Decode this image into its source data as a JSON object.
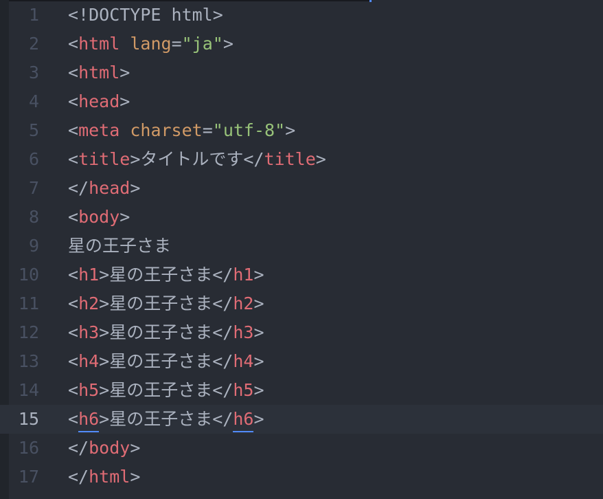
{
  "colors": {
    "background": "#282c34",
    "gutter_text": "#495162",
    "active_line": "#2c313a",
    "tag": "#e06c75",
    "attribute": "#d19a66",
    "string": "#98c379",
    "text": "#abb2bf",
    "bracket_match": "#528bff"
  },
  "editor": {
    "active_line": 15,
    "lines": [
      {
        "no": "1",
        "tokens": [
          {
            "t": "<!DOCTYPE html>",
            "c": "punc"
          }
        ]
      },
      {
        "no": "2",
        "tokens": [
          {
            "t": "<",
            "c": "punc"
          },
          {
            "t": "html",
            "c": "tag"
          },
          {
            "t": " ",
            "c": "punc"
          },
          {
            "t": "lang",
            "c": "attr"
          },
          {
            "t": "=",
            "c": "punc"
          },
          {
            "t": "\"ja\"",
            "c": "str"
          },
          {
            "t": ">",
            "c": "punc"
          }
        ]
      },
      {
        "no": "3",
        "tokens": [
          {
            "t": "<",
            "c": "punc"
          },
          {
            "t": "html",
            "c": "tag"
          },
          {
            "t": ">",
            "c": "punc"
          }
        ]
      },
      {
        "no": "4",
        "tokens": [
          {
            "t": "<",
            "c": "punc"
          },
          {
            "t": "head",
            "c": "tag"
          },
          {
            "t": ">",
            "c": "punc"
          }
        ]
      },
      {
        "no": "5",
        "tokens": [
          {
            "t": "<",
            "c": "punc"
          },
          {
            "t": "meta",
            "c": "tag"
          },
          {
            "t": " ",
            "c": "punc"
          },
          {
            "t": "charset",
            "c": "attr"
          },
          {
            "t": "=",
            "c": "punc"
          },
          {
            "t": "\"utf-8\"",
            "c": "str"
          },
          {
            "t": ">",
            "c": "punc"
          }
        ]
      },
      {
        "no": "6",
        "tokens": [
          {
            "t": "<",
            "c": "punc"
          },
          {
            "t": "title",
            "c": "tag"
          },
          {
            "t": ">タイトルです</",
            "c": "punc"
          },
          {
            "t": "title",
            "c": "tag"
          },
          {
            "t": ">",
            "c": "punc"
          }
        ]
      },
      {
        "no": "7",
        "tokens": [
          {
            "t": "</",
            "c": "punc"
          },
          {
            "t": "head",
            "c": "tag"
          },
          {
            "t": ">",
            "c": "punc"
          }
        ]
      },
      {
        "no": "8",
        "tokens": [
          {
            "t": "<",
            "c": "punc"
          },
          {
            "t": "body",
            "c": "tag"
          },
          {
            "t": ">",
            "c": "punc"
          }
        ]
      },
      {
        "no": "9",
        "tokens": [
          {
            "t": "星の王子さま",
            "c": "punc"
          }
        ]
      },
      {
        "no": "10",
        "tokens": [
          {
            "t": "<",
            "c": "punc"
          },
          {
            "t": "h1",
            "c": "tag"
          },
          {
            "t": ">星の王子さま</",
            "c": "punc"
          },
          {
            "t": "h1",
            "c": "tag"
          },
          {
            "t": ">",
            "c": "punc"
          }
        ]
      },
      {
        "no": "11",
        "tokens": [
          {
            "t": "<",
            "c": "punc"
          },
          {
            "t": "h2",
            "c": "tag"
          },
          {
            "t": ">星の王子さま</",
            "c": "punc"
          },
          {
            "t": "h2",
            "c": "tag"
          },
          {
            "t": ">",
            "c": "punc"
          }
        ]
      },
      {
        "no": "12",
        "tokens": [
          {
            "t": "<",
            "c": "punc"
          },
          {
            "t": "h3",
            "c": "tag"
          },
          {
            "t": ">星の王子さま</",
            "c": "punc"
          },
          {
            "t": "h3",
            "c": "tag"
          },
          {
            "t": ">",
            "c": "punc"
          }
        ]
      },
      {
        "no": "13",
        "tokens": [
          {
            "t": "<",
            "c": "punc"
          },
          {
            "t": "h4",
            "c": "tag"
          },
          {
            "t": ">星の王子さま</",
            "c": "punc"
          },
          {
            "t": "h4",
            "c": "tag"
          },
          {
            "t": ">",
            "c": "punc"
          }
        ]
      },
      {
        "no": "14",
        "tokens": [
          {
            "t": "<",
            "c": "punc"
          },
          {
            "t": "h5",
            "c": "tag"
          },
          {
            "t": ">星の王子さま</",
            "c": "punc"
          },
          {
            "t": "h5",
            "c": "tag"
          },
          {
            "t": ">",
            "c": "punc"
          }
        ]
      },
      {
        "no": "15",
        "tokens": [
          {
            "t": "<",
            "c": "punc"
          },
          {
            "t": "h6",
            "c": "tag",
            "match": true
          },
          {
            "t": ">星の王子さま</",
            "c": "punc"
          },
          {
            "t": "h6",
            "c": "tag",
            "match": true
          },
          {
            "t": ">",
            "c": "punc"
          }
        ]
      },
      {
        "no": "16",
        "tokens": [
          {
            "t": "</",
            "c": "punc"
          },
          {
            "t": "body",
            "c": "tag"
          },
          {
            "t": ">",
            "c": "punc"
          }
        ]
      },
      {
        "no": "17",
        "tokens": [
          {
            "t": "</",
            "c": "punc"
          },
          {
            "t": "html",
            "c": "tag"
          },
          {
            "t": ">",
            "c": "punc"
          }
        ]
      }
    ]
  }
}
